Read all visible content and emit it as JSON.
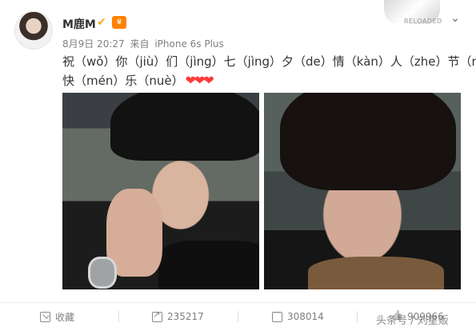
{
  "post": {
    "username": "M鹿M",
    "date": "8月9日 20:27",
    "source_prefix": "来自",
    "source": "iPhone 6s Plus",
    "corner_thumb_label": "RELOADED",
    "text_line1": "祝（wǒ）你（jiù）们（jìng）七（jìng）夕（de）情（kàn）人（zhe）节（nǐ）",
    "text_line2": "快（mén）乐（nuè）",
    "hearts": "❤❤❤"
  },
  "actions": {
    "favorite_label": "收藏",
    "share_count": "235217",
    "comment_count": "308014",
    "like_count": "909966"
  },
  "watermark": "头条号 / 刘星贩",
  "icons": {
    "verified": "verified-v-icon",
    "vip": "vip-icon",
    "menu": "chevron-down-icon",
    "favorite": "favorite-icon",
    "share": "share-icon",
    "comment": "comment-icon",
    "like": "like-icon"
  },
  "colors": {
    "heart": "#ff3b3b",
    "verified": "#f5a623",
    "vip": "#ff8200",
    "meta_text": "#808080"
  }
}
